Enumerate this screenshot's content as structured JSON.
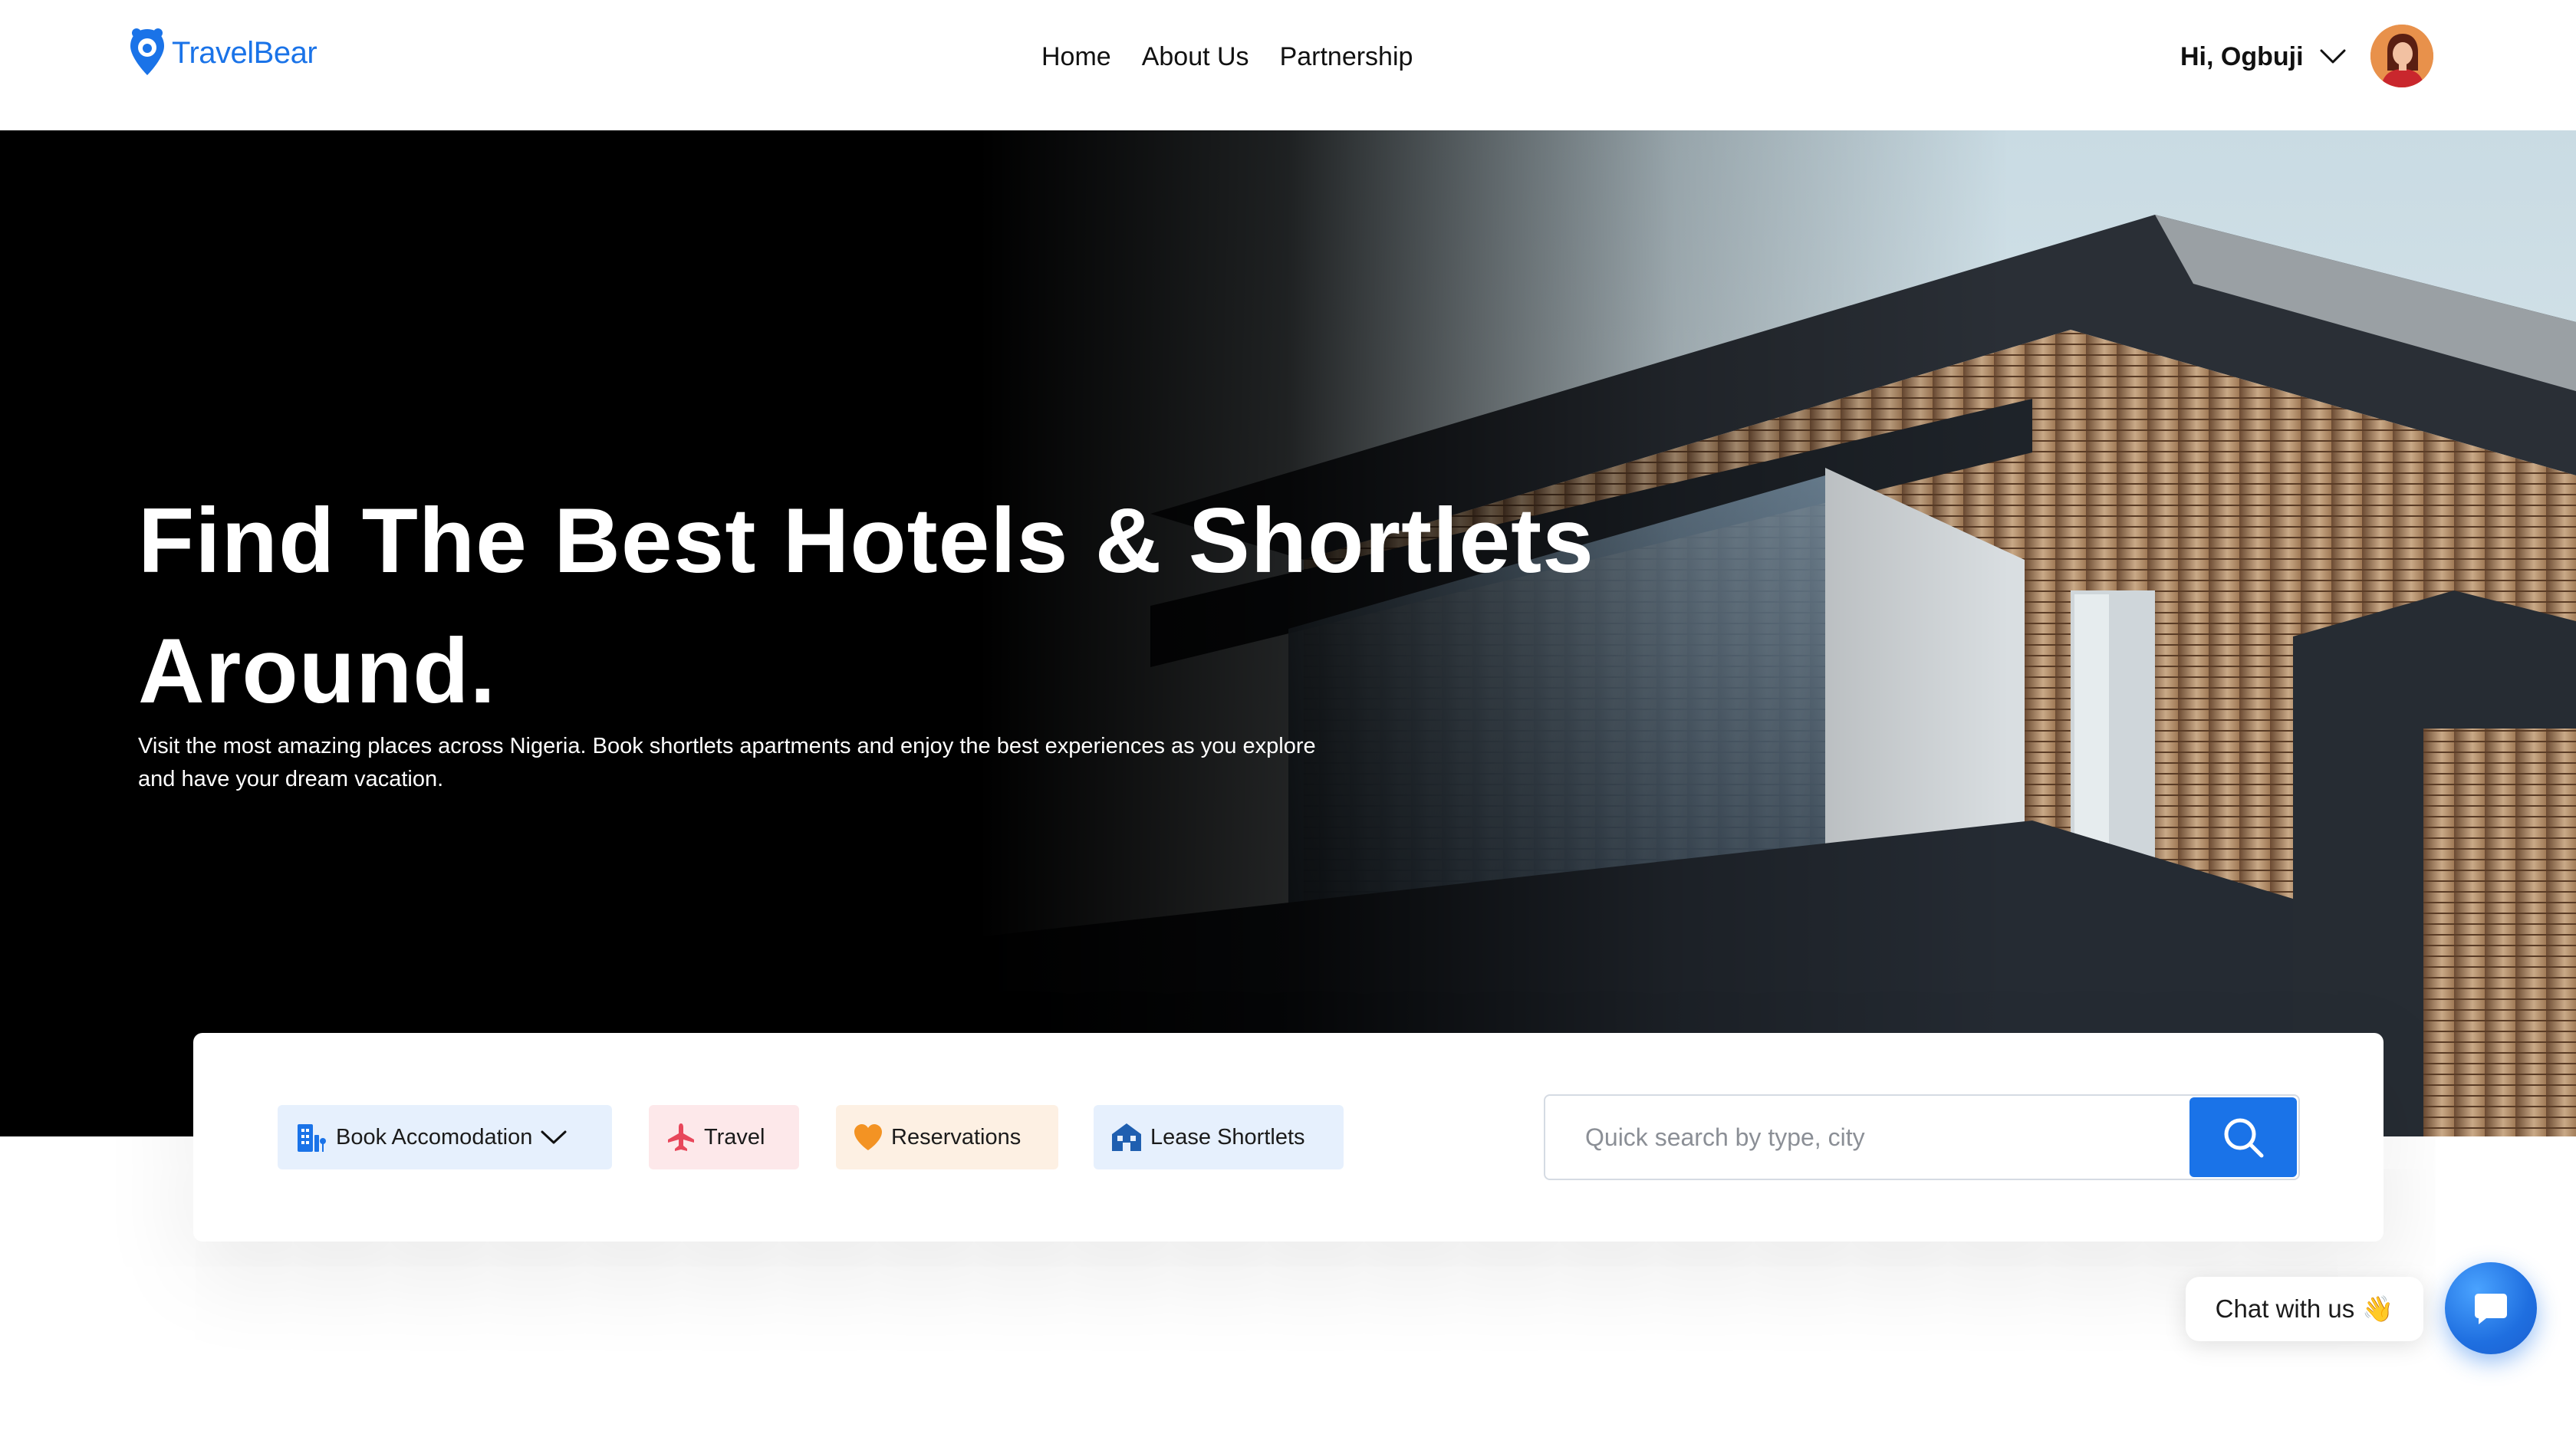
{
  "header": {
    "logo_text": "TravelBear",
    "nav": [
      {
        "label": "Home"
      },
      {
        "label": "About Us"
      },
      {
        "label": "Partnership"
      }
    ],
    "greeting": "Hi, Ogbuji"
  },
  "hero": {
    "title": "Find The Best Hotels & Shortlets Around.",
    "subtitle": "Visit the most amazing places across Nigeria. Book shortlets apartments and enjoy the best experiences as you explore and have your dream vacation."
  },
  "search": {
    "categories": [
      {
        "label": "Book Accomodation",
        "icon": "building-icon"
      },
      {
        "label": "Travel",
        "icon": "plane-icon"
      },
      {
        "label": "Reservations",
        "icon": "heart-icon"
      },
      {
        "label": "Lease Shortlets",
        "icon": "house-icon"
      }
    ],
    "placeholder": "Quick search by type, city"
  },
  "chat": {
    "label": "Chat with us",
    "emoji": "👋"
  },
  "colors": {
    "brand": "#1a73e8",
    "hero_bg": "#000000",
    "accom_pill": "#e6f0fd",
    "travel_pill": "#fde8ea",
    "reservations_pill": "#fdf0e3",
    "lease_pill": "#e6f0fd"
  }
}
